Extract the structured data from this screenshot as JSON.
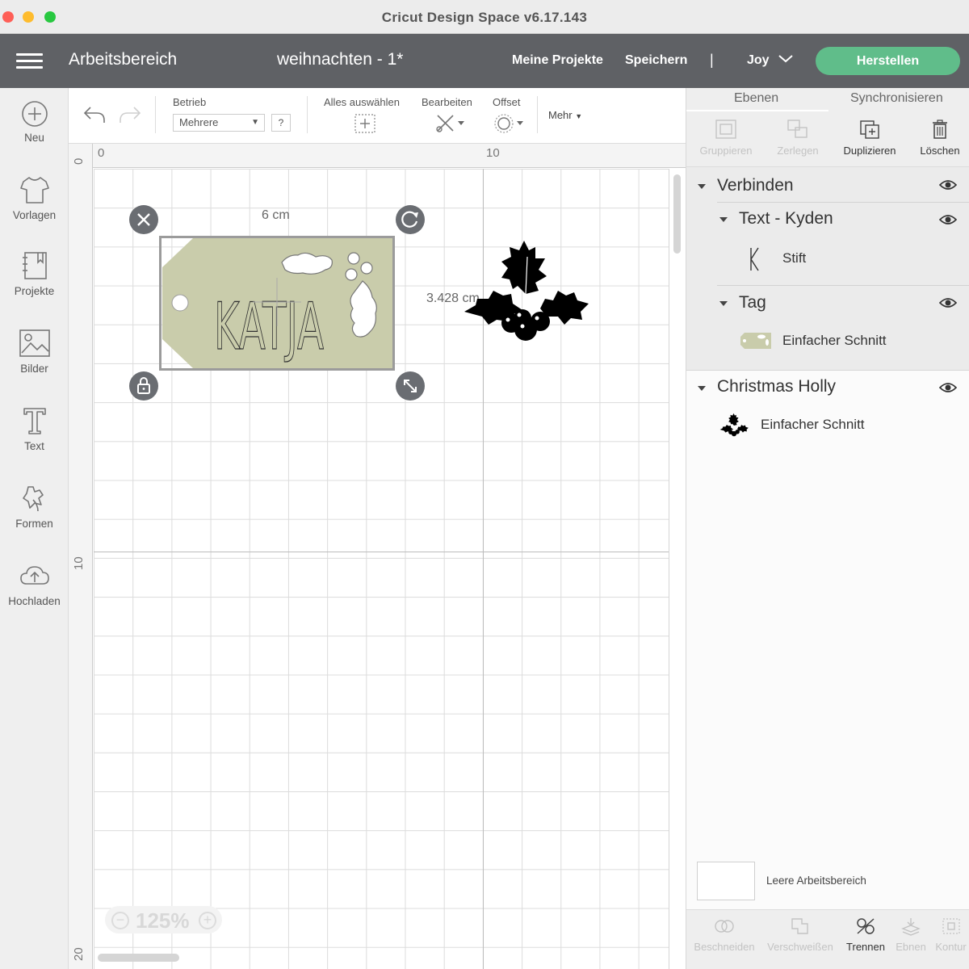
{
  "window": {
    "title": "Cricut Design Space  v6.17.143"
  },
  "header": {
    "workspace": "Arbeitsbereich",
    "project_name": "weihnachten - 1*",
    "my_projects": "Meine Projekte",
    "save": "Speichern",
    "separator": "|",
    "user": "Joy",
    "make": "Herstellen",
    "make_color": "#60bd8a"
  },
  "sidebar": {
    "items": [
      {
        "label": "Neu",
        "icon": "plus-circle-icon"
      },
      {
        "label": "Vorlagen",
        "icon": "tshirt-icon"
      },
      {
        "label": "Projekte",
        "icon": "notebook-icon"
      },
      {
        "label": "Bilder",
        "icon": "image-icon"
      },
      {
        "label": "Text",
        "icon": "text-icon"
      },
      {
        "label": "Formen",
        "icon": "shapes-icon"
      },
      {
        "label": "Hochladen",
        "icon": "cloud-upload-icon"
      }
    ]
  },
  "toolbar": {
    "betrieb_label": "Betrieb",
    "betrieb_value": "Mehrere",
    "help": "?",
    "select_all": "Alles auswählen",
    "edit": "Bearbeiten",
    "offset": "Offset",
    "more": "Mehr"
  },
  "canvas": {
    "ruler_top": [
      "0",
      "10"
    ],
    "ruler_left": [
      "0",
      "10",
      "20"
    ],
    "width_label": "6 cm",
    "height_label": "3.428 cm",
    "tag_text": "KATJA",
    "zoom": "125%",
    "zoom_minus": "−",
    "zoom_plus": "+"
  },
  "panel": {
    "tabs": [
      "Ebenen",
      "Synchronisieren"
    ],
    "actions": [
      "Gruppieren",
      "Zerlegen",
      "Duplizieren",
      "Löschen"
    ],
    "layers": {
      "group": "Verbinden",
      "text_group": "Text - Kyden",
      "text_item": "Stift",
      "tag_group": "Tag",
      "tag_item": "Einfacher Schnitt",
      "holly_group": "Christmas Holly",
      "holly_item": "Einfacher Schnitt"
    },
    "blank_canvas": "Leere Arbeitsbereich",
    "bottom_actions": [
      "Beschneiden",
      "Verschweißen",
      "Trennen",
      "Ebnen",
      "Kontur"
    ]
  }
}
